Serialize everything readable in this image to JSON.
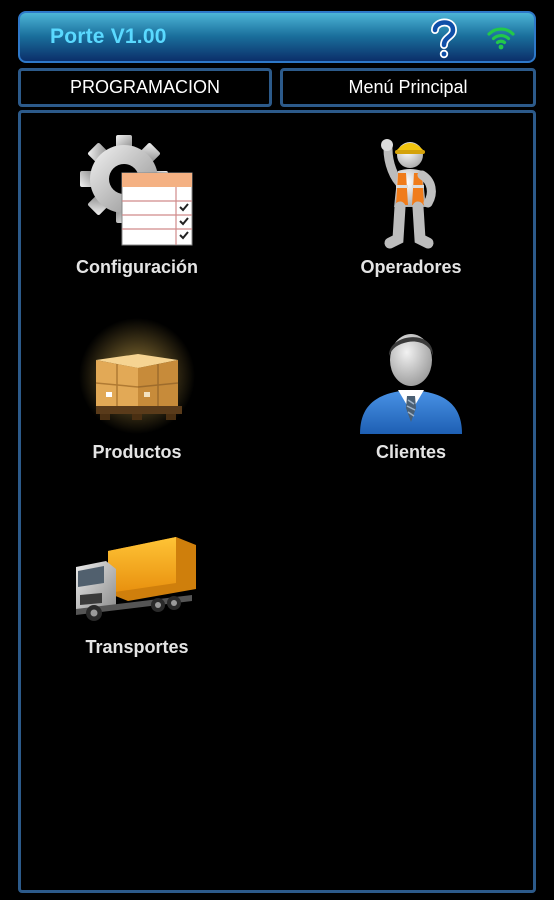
{
  "header": {
    "title": "Porte V1.00",
    "help_icon": "question-mark-icon",
    "status_icon": "wifi-signal-icon"
  },
  "tabs": {
    "programacion": "PROGRAMACION",
    "menu_principal": "Menú Principal"
  },
  "menu": {
    "items": [
      {
        "label": "Configuración",
        "icon": "gear-spreadsheet-icon"
      },
      {
        "label": "Operadores",
        "icon": "worker-icon"
      },
      {
        "label": "Productos",
        "icon": "boxes-pallet-icon"
      },
      {
        "label": "Clientes",
        "icon": "businessman-icon"
      },
      {
        "label": "Transportes",
        "icon": "truck-icon"
      }
    ]
  },
  "colors": {
    "accent": "#5ad9ff",
    "border": "#2c5a8a",
    "background": "#000000",
    "wifi": "#22c84a"
  }
}
